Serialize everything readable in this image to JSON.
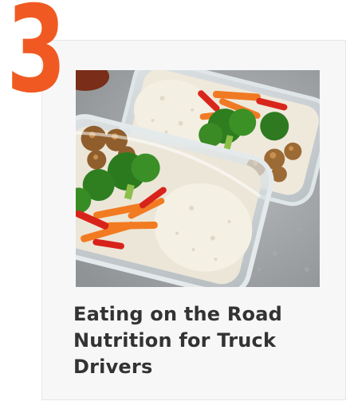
{
  "card": {
    "rank": "3",
    "title_line1": "Eating on the Road",
    "title_line2": "Nutrition for Truck",
    "title_line3": "Drivers",
    "image_icon": "meal-prep-photo"
  },
  "colors": {
    "rank": "#f05a22",
    "title": "#333333",
    "card_background": "#f7f7f7"
  }
}
